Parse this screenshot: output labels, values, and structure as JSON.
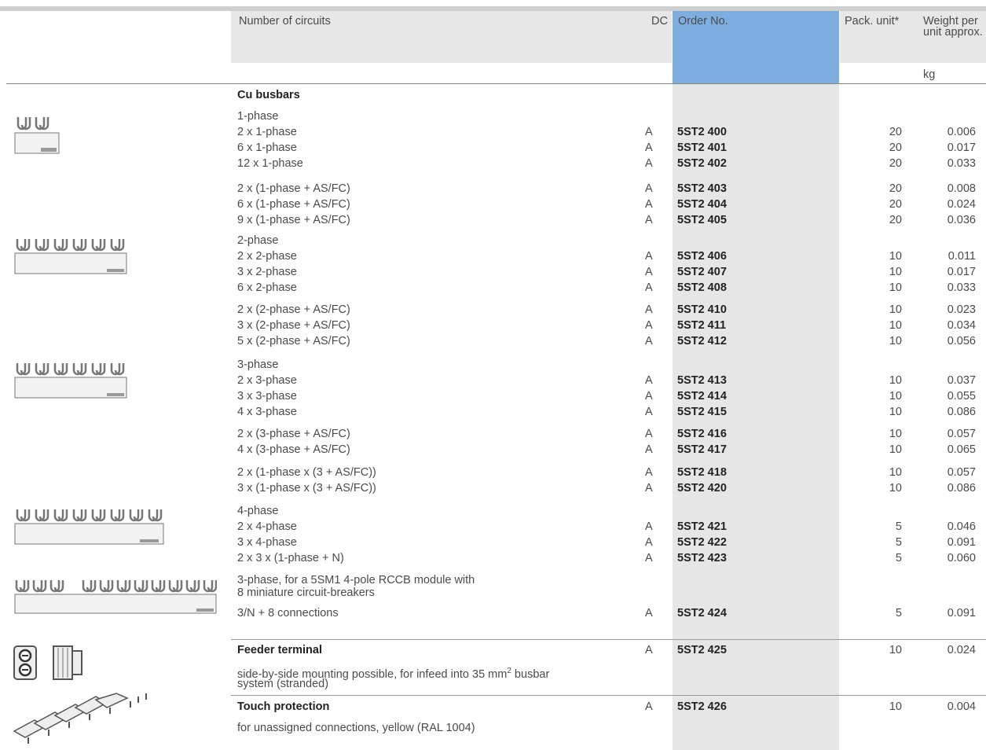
{
  "header": {
    "circuits": "Number of circuits",
    "dc": "DC",
    "order": "Order No.",
    "pack": "Pack. unit*",
    "weight": "Weight per unit approx.",
    "unit": "kg"
  },
  "section_cu": "Cu busbars",
  "groups": {
    "p1": "1-phase",
    "p2": "2-phase",
    "p3": "3-phase",
    "p4": "4-phase",
    "rccb1": "3-phase, for a 5SM1 4-pole RCCB module with",
    "rccb2": "8 miniature circuit-breakers"
  },
  "rows": [
    {
      "circuits": "2 x 1-phase",
      "dc": "A",
      "order": "5ST2 400",
      "pack": "20",
      "weight": "0.006"
    },
    {
      "circuits": "6 x 1-phase",
      "dc": "A",
      "order": "5ST2 401",
      "pack": "20",
      "weight": "0.017"
    },
    {
      "circuits": "12 x 1-phase",
      "dc": "A",
      "order": "5ST2 402",
      "pack": "20",
      "weight": "0.033"
    },
    {
      "circuits": "2 x (1-phase + AS/FC)",
      "dc": "A",
      "order": "5ST2 403",
      "pack": "20",
      "weight": "0.008"
    },
    {
      "circuits": "6 x (1-phase + AS/FC)",
      "dc": "A",
      "order": "5ST2 404",
      "pack": "20",
      "weight": "0.024"
    },
    {
      "circuits": "9 x (1-phase + AS/FC)",
      "dc": "A",
      "order": "5ST2 405",
      "pack": "20",
      "weight": "0.036"
    },
    {
      "circuits": "2 x 2-phase",
      "dc": "A",
      "order": "5ST2 406",
      "pack": "10",
      "weight": "0.011"
    },
    {
      "circuits": "3 x 2-phase",
      "dc": "A",
      "order": "5ST2 407",
      "pack": "10",
      "weight": "0.017"
    },
    {
      "circuits": "6 x 2-phase",
      "dc": "A",
      "order": "5ST2 408",
      "pack": "10",
      "weight": "0.033"
    },
    {
      "circuits": "2 x (2-phase + AS/FC)",
      "dc": "A",
      "order": "5ST2 410",
      "pack": "10",
      "weight": "0.023"
    },
    {
      "circuits": "3 x (2-phase + AS/FC)",
      "dc": "A",
      "order": "5ST2 411",
      "pack": "10",
      "weight": "0.034"
    },
    {
      "circuits": "5 x (2-phase + AS/FC)",
      "dc": "A",
      "order": "5ST2 412",
      "pack": "10",
      "weight": "0.056"
    },
    {
      "circuits": "2 x 3-phase",
      "dc": "A",
      "order": "5ST2 413",
      "pack": "10",
      "weight": "0.037"
    },
    {
      "circuits": "3 x 3-phase",
      "dc": "A",
      "order": "5ST2 414",
      "pack": "10",
      "weight": "0.055"
    },
    {
      "circuits": "4 x 3-phase",
      "dc": "A",
      "order": "5ST2 415",
      "pack": "10",
      "weight": "0.086"
    },
    {
      "circuits": "2 x (3-phase + AS/FC)",
      "dc": "A",
      "order": "5ST2 416",
      "pack": "10",
      "weight": "0.057"
    },
    {
      "circuits": "4 x (3-phase + AS/FC)",
      "dc": "A",
      "order": "5ST2 417",
      "pack": "10",
      "weight": "0.065"
    },
    {
      "circuits": "2 x (1-phase x (3 + AS/FC))",
      "dc": "A",
      "order": "5ST2 418",
      "pack": "10",
      "weight": "0.057"
    },
    {
      "circuits": "3 x (1-phase x (3 + AS/FC))",
      "dc": "A",
      "order": "5ST2 420",
      "pack": "10",
      "weight": "0.086"
    },
    {
      "circuits": "2 x 4-phase",
      "dc": "A",
      "order": "5ST2 421",
      "pack": "5",
      "weight": "0.046"
    },
    {
      "circuits": "3 x 4-phase",
      "dc": "A",
      "order": "5ST2 422",
      "pack": "5",
      "weight": "0.091"
    },
    {
      "circuits": "2 x 3 x (1-phase + N)",
      "dc": "A",
      "order": "5ST2 423",
      "pack": "5",
      "weight": "0.060"
    },
    {
      "circuits": "3/N + 8 connections",
      "dc": "A",
      "order": "5ST2 424",
      "pack": "5",
      "weight": "0.091"
    }
  ],
  "feeder": {
    "title": "Feeder terminal",
    "dc": "A",
    "order": "5ST2 425",
    "pack": "10",
    "weight": "0.024",
    "desc1": "side-by-side mounting possible, for infeed into 35 mm",
    "sup": "2",
    "desc1b": " busbar",
    "desc2": "system (stranded)"
  },
  "touch": {
    "title": "Touch protection",
    "dc": "A",
    "order": "5ST2 426",
    "pack": "10",
    "weight": "0.004",
    "desc": "for unassigned connections, yellow (RAL 1004)"
  }
}
